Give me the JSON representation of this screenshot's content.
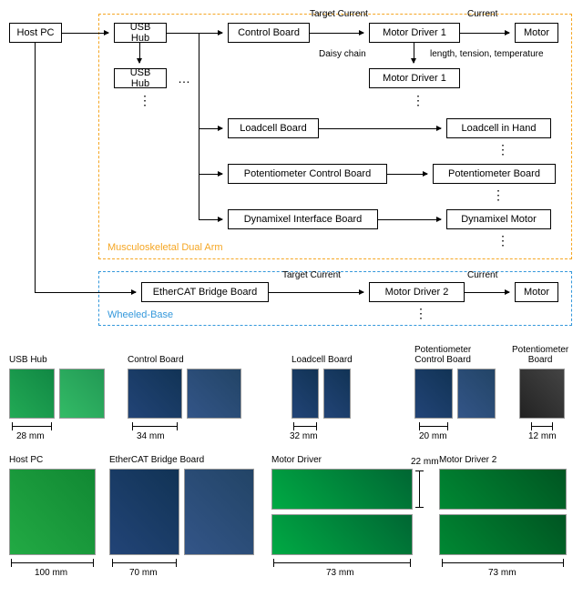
{
  "diagram": {
    "host_pc": "Host PC",
    "usb_hub_1": "USB Hub",
    "usb_hub_2": "USB Hub",
    "control_board": "Control Board",
    "motor_driver_1a": "Motor Driver 1",
    "motor_driver_1b": "Motor Driver 1",
    "motor_top": "Motor",
    "loadcell_board": "Loadcell Board",
    "loadcell_in_hand": "Loadcell in Hand",
    "pot_control_board": "Potentiometer Control Board",
    "pot_board": "Potentiometer Board",
    "dyn_if_board": "Dynamixel Interface Board",
    "dyn_motor": "Dynamixel Motor",
    "ethercat_board": "EtherCAT Bridge Board",
    "motor_driver_2": "Motor Driver 2",
    "motor_bottom": "Motor",
    "group_arm": "Musculoskeletal Dual Arm",
    "group_base": "Wheeled-Base",
    "edge_target_current_1": "Target Current",
    "edge_current_1": "Current",
    "edge_daisy_chain": "Daisy chain",
    "edge_sensor_out": "length, tension, temperature",
    "edge_target_current_2": "Target Current",
    "edge_current_2": "Current"
  },
  "gallery": {
    "usb_hub": {
      "label": "USB Hub",
      "dim": "28 mm"
    },
    "control_board": {
      "label": "Control Board",
      "dim": "34 mm"
    },
    "loadcell_board": {
      "label": "Loadcell Board",
      "dim": "32 mm"
    },
    "pot_ctrl_board": {
      "label": "Potentiometer\nControl Board",
      "dim": "20 mm"
    },
    "pot_board": {
      "label": "Potentiometer\nBoard",
      "dim": "12 mm"
    },
    "host_pc": {
      "label": "Host PC",
      "dim": "100 mm"
    },
    "ethercat": {
      "label": "EtherCAT Bridge Board",
      "dim": "70 mm"
    },
    "motor_driver": {
      "label": "Motor Driver",
      "dim_w": "73 mm",
      "dim_h": "22 mm"
    },
    "motor_driver_2": {
      "label": "Motor Driver 2",
      "dim": "73 mm"
    }
  }
}
